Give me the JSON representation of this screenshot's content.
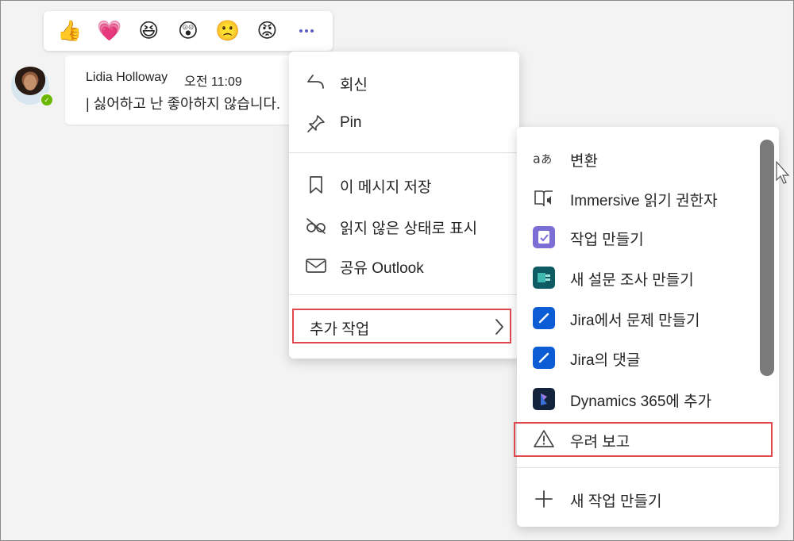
{
  "reactions": [
    {
      "icon": "thumbs-up-icon",
      "glyph": "👍"
    },
    {
      "icon": "heart-icon",
      "glyph": "💗"
    },
    {
      "icon": "laughing-face-icon",
      "glyph": "😆"
    },
    {
      "icon": "surprised-face-icon",
      "glyph": "😲"
    },
    {
      "icon": "sad-face-icon",
      "glyph": "🙁"
    },
    {
      "icon": "angry-face-icon",
      "glyph": "😡"
    }
  ],
  "message": {
    "author": "Lidia Holloway",
    "time": "오전 11:09",
    "text": "| 싫어하고 난 좋아하지 않습니다."
  },
  "context_menu": {
    "items": [
      {
        "label": "회신",
        "icon": "reply-icon"
      },
      {
        "label": "Pin",
        "icon": "pin-icon"
      },
      {
        "label": "이 메시지 저장",
        "icon": "bookmark-icon"
      },
      {
        "label": "읽지 않은 상태로 표시",
        "icon": "mark-unread-icon"
      },
      {
        "label": "공유 Outlook",
        "icon": "mail-icon"
      }
    ],
    "more_actions": {
      "label": "추가 작업",
      "icon": "chevron-right-icon"
    }
  },
  "submenu": {
    "items": [
      {
        "label": "변환",
        "icon": "translate-icon"
      },
      {
        "label": "Immersive 읽기 권한자",
        "icon": "immersive-reader-icon"
      },
      {
        "label": "작업 만들기",
        "icon": "tasks-app-icon"
      },
      {
        "label": "새 설문 조사 만들기",
        "icon": "forms-app-icon"
      },
      {
        "label": "Jira에서 문제 만들기",
        "icon": "jira-icon"
      },
      {
        "label": "Jira의 댓글",
        "icon": "jira-icon"
      },
      {
        "label": "Dynamics 365에 추가",
        "icon": "dynamics-365-icon"
      }
    ],
    "report": {
      "label": "우려 보고",
      "icon": "warning-icon"
    },
    "create_new": {
      "label": "새 작업 만들기",
      "icon": "plus-icon"
    }
  },
  "colors": {
    "highlight_border": "#e0484d",
    "teams_purple": "#5b5fc7",
    "presence_green": "#6bb700",
    "jira_blue": "#0b5cd5"
  }
}
